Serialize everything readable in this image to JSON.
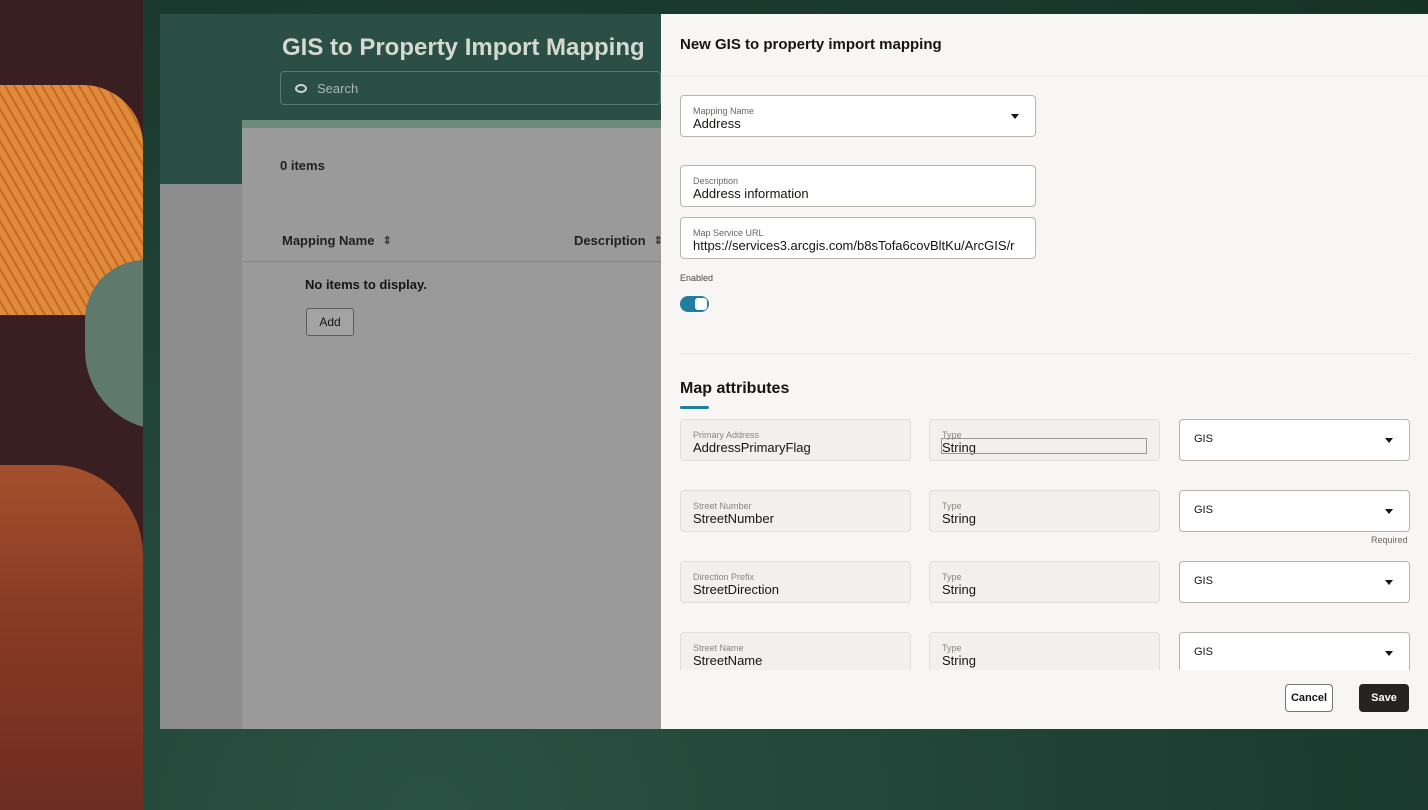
{
  "page": {
    "title": "GIS to Property Import Mapping",
    "search_placeholder": "Search",
    "items_count": "0 items",
    "columns": [
      "Mapping Name",
      "Description"
    ],
    "empty_message": "No items to display.",
    "add_label": "Add"
  },
  "drawer": {
    "title": "New GIS to property import mapping",
    "mapping_name": {
      "label": "Mapping Name",
      "value": "Address"
    },
    "description": {
      "label": "Description",
      "value": "Address information"
    },
    "map_service_url": {
      "label": "Map Service URL",
      "value": "https://services3.arcgis.com/b8sTofa6covBltKu/ArcGIS/r"
    },
    "enabled": {
      "label": "Enabled",
      "value": true
    },
    "section_title": "Map attributes",
    "attributes": [
      {
        "label": "Primary Address",
        "value": "AddressPrimaryFlag",
        "type_label": "Type",
        "type_value": "String",
        "source": "GIS",
        "required_text": ""
      },
      {
        "label": "Street Number",
        "value": "StreetNumber",
        "type_label": "Type",
        "type_value": "String",
        "source": "GIS",
        "required_text": "Required"
      },
      {
        "label": "Direction Prefix",
        "value": "StreetDirection",
        "type_label": "Type",
        "type_value": "String",
        "source": "GIS",
        "required_text": ""
      },
      {
        "label": "Street Name",
        "value": "StreetName",
        "type_label": "Type",
        "type_value": "String",
        "source": "GIS",
        "required_text": ""
      }
    ],
    "cancel_label": "Cancel",
    "save_label": "Save"
  },
  "colors": {
    "accent": "#227e9e",
    "primary_button": "#262422",
    "drawer_bg": "#f7f6f4",
    "header_bg": "#2b4f45"
  }
}
